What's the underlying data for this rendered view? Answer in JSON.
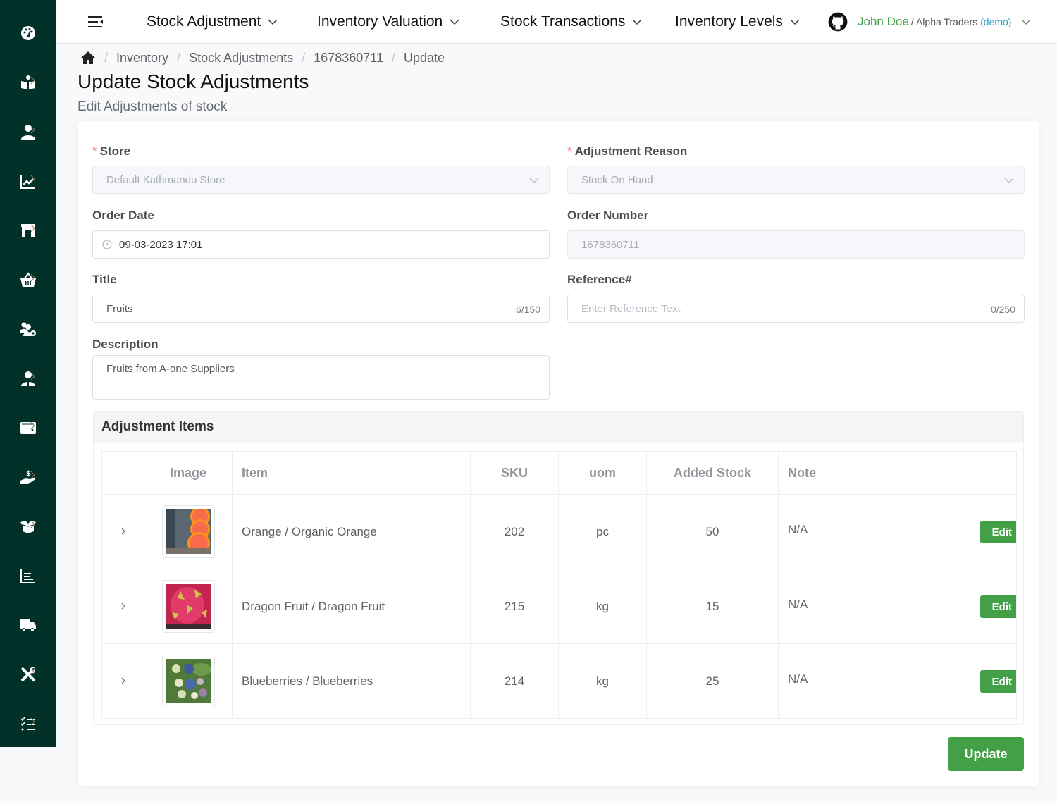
{
  "sidebar": {
    "items": [
      {
        "icon": "dashboard-icon"
      },
      {
        "icon": "reader-icon"
      },
      {
        "icon": "user-icon"
      },
      {
        "icon": "chart-line-icon"
      },
      {
        "icon": "store-icon"
      },
      {
        "icon": "basket-icon"
      },
      {
        "icon": "users-cog-icon"
      },
      {
        "icon": "user-tie-icon"
      },
      {
        "icon": "wallet-icon"
      },
      {
        "icon": "hand-dollar-icon"
      },
      {
        "icon": "box-open-icon"
      },
      {
        "icon": "bar-chart-icon"
      },
      {
        "icon": "truck-icon"
      },
      {
        "icon": "tools-icon"
      },
      {
        "icon": "task-list-icon"
      }
    ]
  },
  "topnav": {
    "items": [
      {
        "label": "Stock Adjustment"
      },
      {
        "label": "Inventory Valuation"
      },
      {
        "label": "Stock Transactions"
      },
      {
        "label": "Inventory Levels"
      }
    ],
    "user": {
      "name": "John Doe",
      "separator": "/",
      "org": "Alpha Traders",
      "demo": "(demo)"
    }
  },
  "breadcrumb": [
    "Inventory",
    "Stock Adjustments",
    "1678360711",
    "Update"
  ],
  "page": {
    "title": "Update Stock Adjustments",
    "subtitle": "Edit Adjustments of stock"
  },
  "form": {
    "store": {
      "label": "Store",
      "value": "Default Kathmandu Store"
    },
    "reason": {
      "label": "Adjustment Reason",
      "value": "Stock On Hand"
    },
    "order_date": {
      "label": "Order Date",
      "value": "09-03-2023 17:01"
    },
    "order_number": {
      "label": "Order Number",
      "value": "1678360711"
    },
    "title": {
      "label": "Title",
      "value": "Fruits",
      "counter": "6/150"
    },
    "reference": {
      "label": "Reference#",
      "placeholder": "Enter Reference Text",
      "counter": "0/250"
    },
    "description": {
      "label": "Description",
      "value": "Fruits from A-one Suppliers"
    }
  },
  "items": {
    "title": "Adjustment Items",
    "columns": [
      "",
      "Image",
      "Item",
      "SKU",
      "uom",
      "Added Stock",
      "Note"
    ],
    "rows": [
      {
        "item": "Orange / Organic Orange",
        "sku": "202",
        "uom": "pc",
        "added": "50",
        "note": "N/A",
        "image": "orange"
      },
      {
        "item": "Dragon Fruit / Dragon Fruit",
        "sku": "215",
        "uom": "kg",
        "added": "15",
        "note": "N/A",
        "image": "dragonfruit"
      },
      {
        "item": "Blueberries / Blueberries",
        "sku": "214",
        "uom": "kg",
        "added": "25",
        "note": "N/A",
        "image": "blueberries"
      }
    ],
    "edit_label": "Edit"
  },
  "actions": {
    "update_label": "Update"
  },
  "colors": {
    "sidebar": "#02312a",
    "accent": "#43a047",
    "required": "#f56c6c",
    "demo": "#29a3c4"
  }
}
